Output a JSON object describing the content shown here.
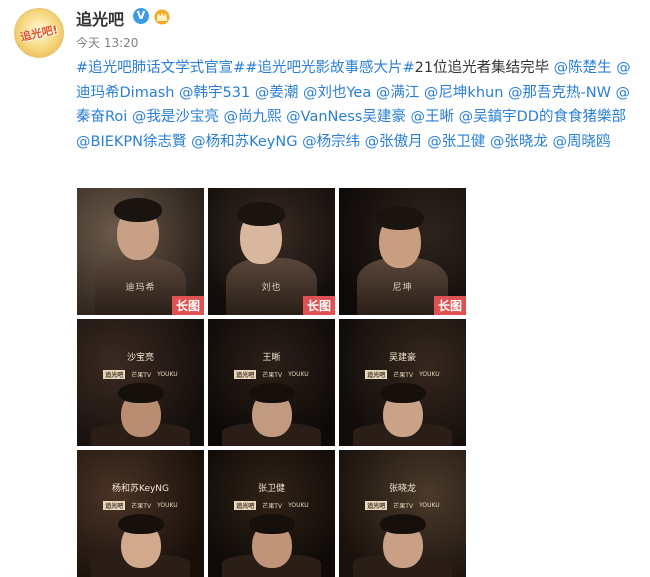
{
  "post": {
    "avatar_text": "追光吧!",
    "username": "追光吧",
    "verified_mark": "V",
    "time": "今天 13:20",
    "text_segments": [
      {
        "t": "#追光吧肺话文学式官宣#",
        "link": true
      },
      {
        "t": "#追光吧光影故事感大片#",
        "link": true
      },
      {
        "t": "21位追光者集结完毕",
        "link": false
      },
      {
        "t": " @陈楚生",
        "link": true
      },
      {
        "t": " @迪玛希Dimash",
        "link": true
      },
      {
        "t": " @韩宇531",
        "link": true
      },
      {
        "t": " @姜潮",
        "link": true
      },
      {
        "t": " @刘也Yea",
        "link": true
      },
      {
        "t": " @满江",
        "link": true
      },
      {
        "t": " @尼坤khun",
        "link": true
      },
      {
        "t": " @那吾克热-NW",
        "link": true
      },
      {
        "t": " @秦奋Roi",
        "link": true
      },
      {
        "t": " @我是沙宝亮",
        "link": true
      },
      {
        "t": " @尚九熙",
        "link": true
      },
      {
        "t": " @VanNess吴建豪",
        "link": true
      },
      {
        "t": " @王晰",
        "link": true
      },
      {
        "t": " @吴鎮宇DD的食食猪樂部",
        "link": true
      },
      {
        "t": " @BIEKPN徐志賢",
        "link": true
      },
      {
        "t": " @杨和苏KeyNG",
        "link": true
      },
      {
        "t": " @杨宗纬",
        "link": true
      },
      {
        "t": " @张傲月",
        "link": true
      },
      {
        "t": " @张卫健",
        "link": true
      },
      {
        "t": " @张晓龙",
        "link": true
      },
      {
        "t": " @周晓鸥",
        "link": true
      }
    ]
  },
  "images": [
    {
      "name": "迪玛希",
      "badge": "长图"
    },
    {
      "name": "刘也",
      "badge": "长图"
    },
    {
      "name": "尼坤",
      "badge": "长图"
    },
    {
      "name": "沙宝亮",
      "badge": ""
    },
    {
      "name": "王晰",
      "badge": ""
    },
    {
      "name": "吴建豪",
      "badge": ""
    },
    {
      "name": "杨和苏KeyNG",
      "badge": ""
    },
    {
      "name": "张卫健",
      "badge": ""
    },
    {
      "name": "张晓龙",
      "badge": ""
    }
  ],
  "image_strip": {
    "left": "追光吧",
    "mid": "芒果TV",
    "right": "YOUKU"
  },
  "colors": {
    "link": "#2a7fd4",
    "badge": "#e05252",
    "verified": "#3d9ce6"
  }
}
